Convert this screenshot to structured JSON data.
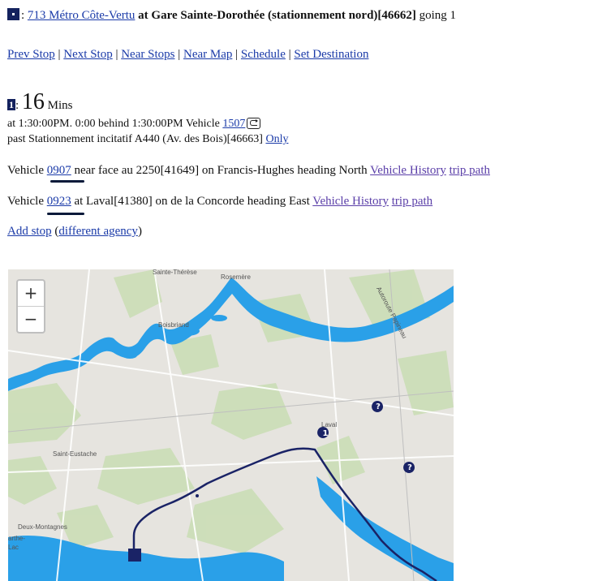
{
  "header": {
    "route_link": "713 Métro Côte-Vertu",
    "at_text": " at ",
    "stop_name": "Gare Sainte-Dorothée (stationnement nord)[46662]",
    "direction": " going 1"
  },
  "nav": {
    "prev": "Prev Stop",
    "next": "Next Stop",
    "near_stops": "Near Stops",
    "near_map": "Near Map",
    "schedule": "Schedule",
    "set_destination": "Set Destination",
    "separator": " | "
  },
  "eta": {
    "index": "1",
    "colon": ":",
    "minutes": "16",
    "unit": "Mins"
  },
  "details": {
    "line1_prefix": "at 1:30:00PM. 0:00 behind 1:30:00PM Vehicle ",
    "vehicle": "1507",
    "line2_prefix": "past Stationnement incitatif A440 (Av. des Bois)[46663] ",
    "only": "Only"
  },
  "vehicles": [
    {
      "prefix": "Vehicle ",
      "id": "0907",
      "text": " near face au 2250[41649] on Francis-Hughes heading North ",
      "history": "Vehicle History",
      "trip": "trip path"
    },
    {
      "prefix": "Vehicle ",
      "id": "0923",
      "text": " at Laval[41380] on de la Concorde heading East ",
      "history": "Vehicle History",
      "trip": "trip path"
    }
  ],
  "add_stop": {
    "label": "Add stop",
    "open": " (",
    "agency": "different agency",
    "close": ")"
  },
  "map": {
    "zoom_in": "+",
    "zoom_out": "−",
    "labels": {
      "sainte_therese": "Sainte-Thérèse",
      "rosemere": "Rosemère",
      "boisbriand": "Boisbriand",
      "saint_eustache": "Saint-Eustache",
      "laval": "Laval",
      "deux_montagnes": "Deux-Montagnes",
      "arthe": "arthe-",
      "lac": "Lac",
      "papineau": "Autoroute Papineau"
    },
    "marker_1": "1",
    "marker_q": "?",
    "water_color": "#2aa0e8",
    "route_color": "#1a2366"
  }
}
